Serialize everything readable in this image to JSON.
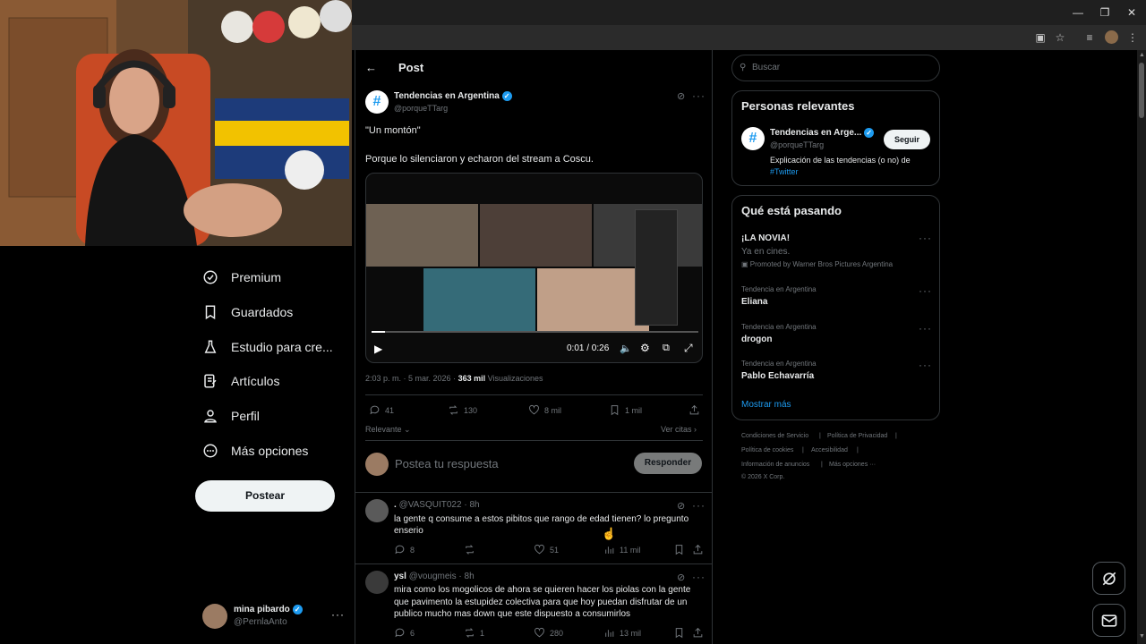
{
  "header": {
    "title": "Post"
  },
  "sidebar": {
    "items": [
      {
        "label": "Premium",
        "icon": "premium-icon"
      },
      {
        "label": "Guardados",
        "icon": "bookmark-icon"
      },
      {
        "label": "Estudio para cre...",
        "icon": "creator-studio-icon"
      },
      {
        "label": "Artículos",
        "icon": "articles-icon"
      },
      {
        "label": "Perfil",
        "icon": "profile-icon"
      },
      {
        "label": "Más opciones",
        "icon": "more-options-icon"
      }
    ],
    "post_button": "Postear",
    "account": {
      "name": "mina pibardo",
      "handle": "@PernlaAnto"
    }
  },
  "tweet": {
    "author_name": "Tendencias en Argentina",
    "author_handle": "@porqueTTarg",
    "line1": "\"Un montón\"",
    "line2": "Porque lo silenciaron y echaron del stream a Coscu.",
    "video_time": "0:01 / 0:26",
    "meta_time": "2:03 p. m. · 5 mar. 2026 ·",
    "views_count": "363 mil",
    "views_label": "Visualizaciones",
    "replies": "41",
    "reposts": "130",
    "likes": "8 mil",
    "bookmarks": "1 mil",
    "sort_label": "Relevante",
    "quotes_label": "Ver citas"
  },
  "composer": {
    "placeholder": "Postea tu respuesta",
    "button": "Responder"
  },
  "replies": [
    {
      "name": ".",
      "handle": "@VASQUIT022",
      "time": "· 8h",
      "text": "la gente q consume a estos pibitos que rango de edad tienen? lo pregunto enserio",
      "replies": "8",
      "reposts": "",
      "likes": "51",
      "views": "11 mil"
    },
    {
      "name": "ysl",
      "handle": "@vougmeis",
      "time": "· 8h",
      "text": "mira como los mogolicos de ahora se quieren hacer los piolas con la gente que pavimento la estupidez colectiva para que hoy puedan disfrutar de un publico mucho mas down que este dispuesto a consumirlos",
      "replies": "6",
      "reposts": "1",
      "likes": "280",
      "views": "13 mil"
    }
  ],
  "search": {
    "placeholder": "Buscar"
  },
  "relevant": {
    "title": "Personas relevantes",
    "name": "Tendencias en Arge...",
    "handle": "@porqueTTarg",
    "follow": "Seguir",
    "bio": "Explicación de las tendencias (o no) de",
    "bio_tag": "#Twitter"
  },
  "trends": {
    "title": "Qué está pasando",
    "promo": {
      "name": "¡LA NOVIA!",
      "sub": "Ya en cines.",
      "promoted": "Promoted by Warner Bros Pictures Argentina"
    },
    "items": [
      {
        "category": "Tendencia en Argentina",
        "name": "Eliana"
      },
      {
        "category": "Tendencia en Argentina",
        "name": "drogon"
      },
      {
        "category": "Tendencia en Argentina",
        "name": "Pablo Echavarría"
      }
    ],
    "show_more": "Mostrar más"
  },
  "footer": {
    "links": [
      "Condiciones de Servicio",
      "Política de Privacidad",
      "Política de cookies",
      "Accesibilidad",
      "Información de anuncios",
      "Más opciones ···"
    ],
    "copyright": "© 2026 X Corp."
  },
  "colors": {
    "accent": "#1d9bf0",
    "background": "#000000",
    "border": "#2f3336",
    "muted": "#71767b"
  }
}
